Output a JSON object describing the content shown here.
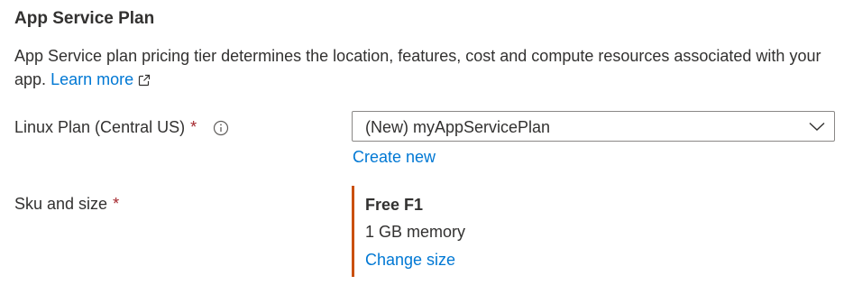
{
  "section": {
    "title": "App Service Plan",
    "description": "App Service plan pricing tier determines the location, features, cost and compute resources associated with your app.",
    "learn_more_label": "Learn more",
    "learn_more_icon": "external-link-icon"
  },
  "linux_plan": {
    "label": "Linux Plan (Central US)",
    "required_marker": "*",
    "info_icon": "info-icon",
    "selected_value": "(New) myAppServicePlan",
    "dropdown_icon": "chevron-down-icon",
    "create_new_label": "Create new"
  },
  "sku": {
    "label": "Sku and size",
    "required_marker": "*",
    "name": "Free F1",
    "memory": "1 GB memory",
    "change_label": "Change size",
    "accent_color": "#ca5010"
  },
  "colors": {
    "link": "#0078d4",
    "text": "#323130",
    "required": "#a4262c",
    "border": "#8a8886"
  }
}
